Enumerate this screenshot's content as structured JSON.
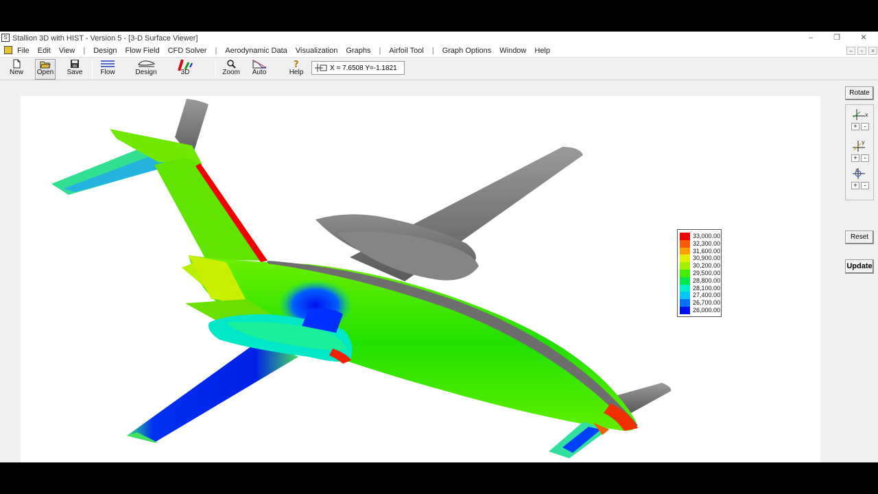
{
  "window": {
    "title": "Stallion 3D with HIST - Version 5 - [3-D Surface Viewer]",
    "controls": {
      "minimize": "–",
      "restore": "❐",
      "close": "✕"
    }
  },
  "menu": {
    "items": [
      "File",
      "Edit",
      "View",
      "|",
      "Design",
      "Flow Field",
      "CFD Solver",
      "|",
      "Aerodynamic Data",
      "Visualization",
      "Graphs",
      "|",
      "Airfoil Tool",
      "|",
      "Graph Options",
      "Window",
      "Help"
    ],
    "mdi_controls": {
      "minimize": "–",
      "restore": "▫",
      "close": "×"
    }
  },
  "toolbar": {
    "new": "New",
    "open": "Open",
    "save": "Save",
    "flow": "Flow",
    "design": "Design",
    "threed": "3D",
    "zoom": "Zoom",
    "auto": "Auto",
    "help": "Help",
    "coord": "X = 7.6508  Y=-1.1821"
  },
  "legend": {
    "entries": [
      {
        "label": "33,000.00",
        "color": "#f00000"
      },
      {
        "label": "32,300.00",
        "color": "#ff5a00"
      },
      {
        "label": "31,600.00",
        "color": "#ffa000"
      },
      {
        "label": "30,900.00",
        "color": "#e0f000"
      },
      {
        "label": "30,200.00",
        "color": "#a0f000"
      },
      {
        "label": "29,500.00",
        "color": "#40f000"
      },
      {
        "label": "28,800.00",
        "color": "#00e84a"
      },
      {
        "label": "28,100.00",
        "color": "#00f0c8"
      },
      {
        "label": "27,400.00",
        "color": "#00c8ff"
      },
      {
        "label": "26,700.00",
        "color": "#0070ff"
      },
      {
        "label": "26,000.00",
        "color": "#0010f0"
      }
    ]
  },
  "side_panel": {
    "rotate": "Rotate",
    "x_axis": "x",
    "y_axis": "y",
    "z_axis": "z",
    "plus": "+",
    "minus": "-",
    "reset": "Reset",
    "update": "Update"
  },
  "colors": {
    "gray_surface": "#7c7c7c",
    "gray_dark": "#5e5e5e",
    "green_surface": "#35e000",
    "blue_surface": "#0020f0",
    "red_surface": "#f00000"
  }
}
